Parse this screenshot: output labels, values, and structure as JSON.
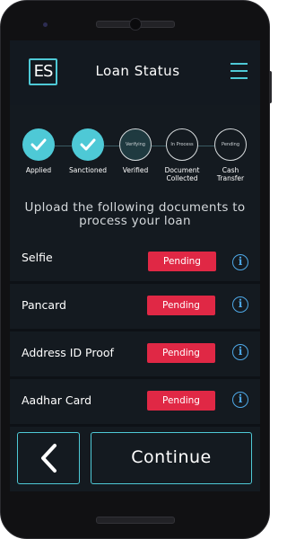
{
  "header": {
    "logo_text": "ES",
    "title": "Loan Status"
  },
  "steps": [
    {
      "label": "Applied",
      "circle_text": "",
      "state": "done"
    },
    {
      "label": "Sanctioned",
      "circle_text": "",
      "state": "done"
    },
    {
      "label": "Verified",
      "circle_text": "Verifying",
      "state": "current"
    },
    {
      "label": "Document Collected",
      "circle_text": "In Process",
      "state": "pending"
    },
    {
      "label": "Cash Transfer",
      "circle_text": "Pending",
      "state": "pending"
    }
  ],
  "heading": "Upload the following documents to process your loan",
  "documents": [
    {
      "name": "Selfie",
      "status": "Pending"
    },
    {
      "name": "Pancard",
      "status": "Pending"
    },
    {
      "name": "Address ID Proof",
      "status": "Pending"
    },
    {
      "name": "Aadhar Card",
      "status": "Pending"
    }
  ],
  "footer": {
    "continue_label": "Continue"
  },
  "colors": {
    "accent": "#4ec9d6",
    "pending": "#e02845",
    "info": "#4ea8e6",
    "background": "#141a20"
  }
}
